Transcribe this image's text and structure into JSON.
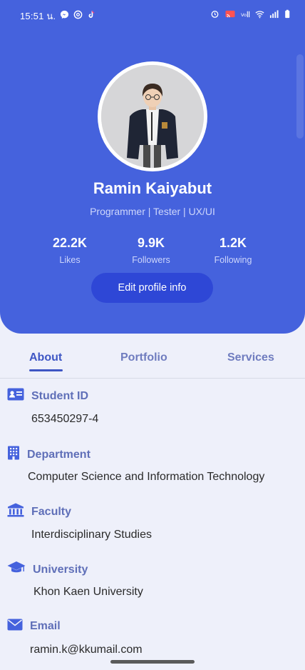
{
  "status_bar": {
    "time": "15:51 น.",
    "left_icons": [
      "messenger-icon",
      "threads-icon",
      "tiktok-icon"
    ],
    "right_icons": [
      "alarm-icon",
      "cast-icon",
      "volte-icon",
      "wifi-icon",
      "signal-icon",
      "battery-icon"
    ]
  },
  "profile": {
    "name": "Ramin Kaiyabut",
    "role": "Programmer | Tester | UX/UI",
    "stats": [
      {
        "value": "22.2K",
        "label": "Likes"
      },
      {
        "value": "9.9K",
        "label": "Followers"
      },
      {
        "value": "1.2K",
        "label": "Following"
      }
    ],
    "edit_label": "Edit profile info"
  },
  "tabs": [
    {
      "label": "About",
      "active": true
    },
    {
      "label": "Portfolio",
      "active": false
    },
    {
      "label": "Services",
      "active": false
    }
  ],
  "about": [
    {
      "icon": "id-card-icon",
      "label": "Student ID",
      "value": "653450297-4"
    },
    {
      "icon": "building-icon",
      "label": "Department",
      "value": "Computer Science and Information Technology"
    },
    {
      "icon": "institution-icon",
      "label": "Faculty",
      "value": "Interdisciplinary Studies"
    },
    {
      "icon": "graduation-cap-icon",
      "label": "University",
      "value": "Khon Kaen University"
    },
    {
      "icon": "envelope-icon",
      "label": "Email",
      "value": "ramin.k@kkumail.com"
    }
  ],
  "colors": {
    "header_bg": "#4562dd",
    "button_bg": "#2e47d6",
    "page_bg": "#eef0fa",
    "accent": "#3e56c4",
    "label": "#5f6fb8"
  }
}
